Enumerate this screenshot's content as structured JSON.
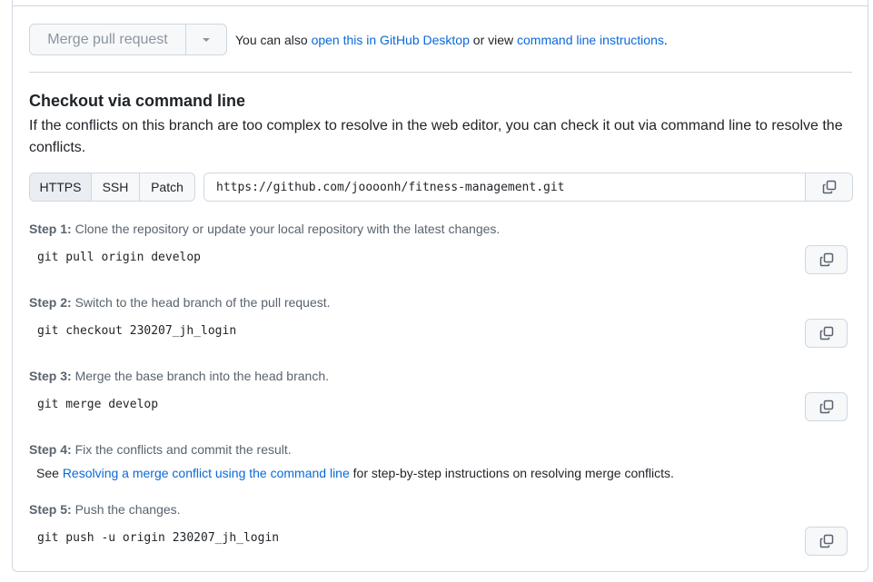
{
  "merge": {
    "button_label": "Merge pull request",
    "note_prefix": "You can also ",
    "desktop_link": "open this in GitHub Desktop",
    "note_middle": " or view ",
    "cli_link": "command line instructions",
    "note_suffix": "."
  },
  "checkout": {
    "heading": "Checkout via command line",
    "description": "If the conflicts on this branch are too complex to resolve in the web editor, you can check it out via command line to resolve the conflicts.",
    "protocols": [
      "HTTPS",
      "SSH",
      "Patch"
    ],
    "active_protocol": "HTTPS",
    "clone_url": "https://github.com/joooonh/fitness-management.git"
  },
  "steps": [
    {
      "label": "Step 1:",
      "text": " Clone the repository or update your local repository with the latest changes.",
      "command": "git pull origin develop"
    },
    {
      "label": "Step 2:",
      "text": " Switch to the head branch of the pull request.",
      "command": "git checkout 230207_jh_login"
    },
    {
      "label": "Step 3:",
      "text": " Merge the base branch into the head branch.",
      "command": "git merge develop"
    },
    {
      "label": "Step 4:",
      "text": " Fix the conflicts and commit the result."
    },
    {
      "label": "Step 5:",
      "text": " Push the changes.",
      "command": "git push -u origin 230207_jh_login"
    }
  ],
  "see": {
    "prefix": "See ",
    "link": "Resolving a merge conflict using the command line",
    "suffix": " for step-by-step instructions on resolving merge conflicts."
  },
  "icons": {
    "copy": "copy-icon",
    "caret": "triangle-down-icon"
  },
  "colors": {
    "link": "#0969da",
    "border": "#d0d7de",
    "muted": "#59636e",
    "button_bg": "#f6f8fa"
  }
}
